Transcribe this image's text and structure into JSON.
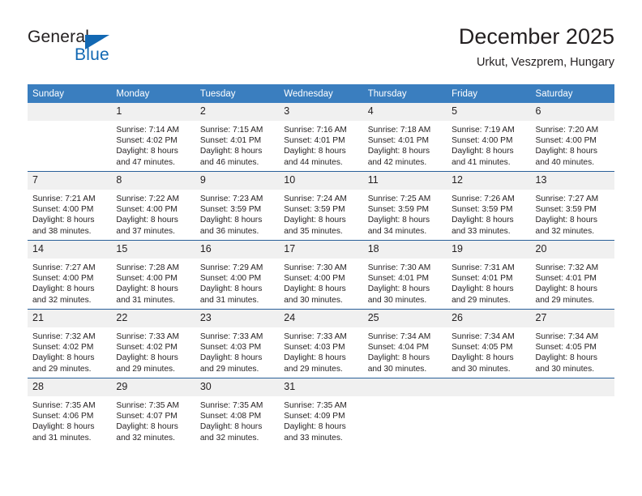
{
  "brand": {
    "word_one": "General",
    "word_two": "Blue",
    "triangle_icon": "triangle-icon",
    "colors": {
      "dark": "#231f20",
      "blue": "#1268b3"
    }
  },
  "header": {
    "title": "December 2025",
    "subtitle": "Urkut, Veszprem, Hungary"
  },
  "calendar": {
    "header_bg": "#3a7ebf",
    "row_rule": "#2a6099",
    "daynum_bg": "#f0f0f0",
    "weekdays": [
      "Sunday",
      "Monday",
      "Tuesday",
      "Wednesday",
      "Thursday",
      "Friday",
      "Saturday"
    ],
    "weeks": [
      [
        {
          "day": "",
          "sunrise": "",
          "sunset": "",
          "daylight1": "",
          "daylight2": ""
        },
        {
          "day": "1",
          "sunrise": "Sunrise: 7:14 AM",
          "sunset": "Sunset: 4:02 PM",
          "daylight1": "Daylight: 8 hours",
          "daylight2": "and 47 minutes."
        },
        {
          "day": "2",
          "sunrise": "Sunrise: 7:15 AM",
          "sunset": "Sunset: 4:01 PM",
          "daylight1": "Daylight: 8 hours",
          "daylight2": "and 46 minutes."
        },
        {
          "day": "3",
          "sunrise": "Sunrise: 7:16 AM",
          "sunset": "Sunset: 4:01 PM",
          "daylight1": "Daylight: 8 hours",
          "daylight2": "and 44 minutes."
        },
        {
          "day": "4",
          "sunrise": "Sunrise: 7:18 AM",
          "sunset": "Sunset: 4:01 PM",
          "daylight1": "Daylight: 8 hours",
          "daylight2": "and 42 minutes."
        },
        {
          "day": "5",
          "sunrise": "Sunrise: 7:19 AM",
          "sunset": "Sunset: 4:00 PM",
          "daylight1": "Daylight: 8 hours",
          "daylight2": "and 41 minutes."
        },
        {
          "day": "6",
          "sunrise": "Sunrise: 7:20 AM",
          "sunset": "Sunset: 4:00 PM",
          "daylight1": "Daylight: 8 hours",
          "daylight2": "and 40 minutes."
        }
      ],
      [
        {
          "day": "7",
          "sunrise": "Sunrise: 7:21 AM",
          "sunset": "Sunset: 4:00 PM",
          "daylight1": "Daylight: 8 hours",
          "daylight2": "and 38 minutes."
        },
        {
          "day": "8",
          "sunrise": "Sunrise: 7:22 AM",
          "sunset": "Sunset: 4:00 PM",
          "daylight1": "Daylight: 8 hours",
          "daylight2": "and 37 minutes."
        },
        {
          "day": "9",
          "sunrise": "Sunrise: 7:23 AM",
          "sunset": "Sunset: 3:59 PM",
          "daylight1": "Daylight: 8 hours",
          "daylight2": "and 36 minutes."
        },
        {
          "day": "10",
          "sunrise": "Sunrise: 7:24 AM",
          "sunset": "Sunset: 3:59 PM",
          "daylight1": "Daylight: 8 hours",
          "daylight2": "and 35 minutes."
        },
        {
          "day": "11",
          "sunrise": "Sunrise: 7:25 AM",
          "sunset": "Sunset: 3:59 PM",
          "daylight1": "Daylight: 8 hours",
          "daylight2": "and 34 minutes."
        },
        {
          "day": "12",
          "sunrise": "Sunrise: 7:26 AM",
          "sunset": "Sunset: 3:59 PM",
          "daylight1": "Daylight: 8 hours",
          "daylight2": "and 33 minutes."
        },
        {
          "day": "13",
          "sunrise": "Sunrise: 7:27 AM",
          "sunset": "Sunset: 3:59 PM",
          "daylight1": "Daylight: 8 hours",
          "daylight2": "and 32 minutes."
        }
      ],
      [
        {
          "day": "14",
          "sunrise": "Sunrise: 7:27 AM",
          "sunset": "Sunset: 4:00 PM",
          "daylight1": "Daylight: 8 hours",
          "daylight2": "and 32 minutes."
        },
        {
          "day": "15",
          "sunrise": "Sunrise: 7:28 AM",
          "sunset": "Sunset: 4:00 PM",
          "daylight1": "Daylight: 8 hours",
          "daylight2": "and 31 minutes."
        },
        {
          "day": "16",
          "sunrise": "Sunrise: 7:29 AM",
          "sunset": "Sunset: 4:00 PM",
          "daylight1": "Daylight: 8 hours",
          "daylight2": "and 31 minutes."
        },
        {
          "day": "17",
          "sunrise": "Sunrise: 7:30 AM",
          "sunset": "Sunset: 4:00 PM",
          "daylight1": "Daylight: 8 hours",
          "daylight2": "and 30 minutes."
        },
        {
          "day": "18",
          "sunrise": "Sunrise: 7:30 AM",
          "sunset": "Sunset: 4:01 PM",
          "daylight1": "Daylight: 8 hours",
          "daylight2": "and 30 minutes."
        },
        {
          "day": "19",
          "sunrise": "Sunrise: 7:31 AM",
          "sunset": "Sunset: 4:01 PM",
          "daylight1": "Daylight: 8 hours",
          "daylight2": "and 29 minutes."
        },
        {
          "day": "20",
          "sunrise": "Sunrise: 7:32 AM",
          "sunset": "Sunset: 4:01 PM",
          "daylight1": "Daylight: 8 hours",
          "daylight2": "and 29 minutes."
        }
      ],
      [
        {
          "day": "21",
          "sunrise": "Sunrise: 7:32 AM",
          "sunset": "Sunset: 4:02 PM",
          "daylight1": "Daylight: 8 hours",
          "daylight2": "and 29 minutes."
        },
        {
          "day": "22",
          "sunrise": "Sunrise: 7:33 AM",
          "sunset": "Sunset: 4:02 PM",
          "daylight1": "Daylight: 8 hours",
          "daylight2": "and 29 minutes."
        },
        {
          "day": "23",
          "sunrise": "Sunrise: 7:33 AM",
          "sunset": "Sunset: 4:03 PM",
          "daylight1": "Daylight: 8 hours",
          "daylight2": "and 29 minutes."
        },
        {
          "day": "24",
          "sunrise": "Sunrise: 7:33 AM",
          "sunset": "Sunset: 4:03 PM",
          "daylight1": "Daylight: 8 hours",
          "daylight2": "and 29 minutes."
        },
        {
          "day": "25",
          "sunrise": "Sunrise: 7:34 AM",
          "sunset": "Sunset: 4:04 PM",
          "daylight1": "Daylight: 8 hours",
          "daylight2": "and 30 minutes."
        },
        {
          "day": "26",
          "sunrise": "Sunrise: 7:34 AM",
          "sunset": "Sunset: 4:05 PM",
          "daylight1": "Daylight: 8 hours",
          "daylight2": "and 30 minutes."
        },
        {
          "day": "27",
          "sunrise": "Sunrise: 7:34 AM",
          "sunset": "Sunset: 4:05 PM",
          "daylight1": "Daylight: 8 hours",
          "daylight2": "and 30 minutes."
        }
      ],
      [
        {
          "day": "28",
          "sunrise": "Sunrise: 7:35 AM",
          "sunset": "Sunset: 4:06 PM",
          "daylight1": "Daylight: 8 hours",
          "daylight2": "and 31 minutes."
        },
        {
          "day": "29",
          "sunrise": "Sunrise: 7:35 AM",
          "sunset": "Sunset: 4:07 PM",
          "daylight1": "Daylight: 8 hours",
          "daylight2": "and 32 minutes."
        },
        {
          "day": "30",
          "sunrise": "Sunrise: 7:35 AM",
          "sunset": "Sunset: 4:08 PM",
          "daylight1": "Daylight: 8 hours",
          "daylight2": "and 32 minutes."
        },
        {
          "day": "31",
          "sunrise": "Sunrise: 7:35 AM",
          "sunset": "Sunset: 4:09 PM",
          "daylight1": "Daylight: 8 hours",
          "daylight2": "and 33 minutes."
        },
        {
          "day": "",
          "sunrise": "",
          "sunset": "",
          "daylight1": "",
          "daylight2": ""
        },
        {
          "day": "",
          "sunrise": "",
          "sunset": "",
          "daylight1": "",
          "daylight2": ""
        },
        {
          "day": "",
          "sunrise": "",
          "sunset": "",
          "daylight1": "",
          "daylight2": ""
        }
      ]
    ]
  }
}
